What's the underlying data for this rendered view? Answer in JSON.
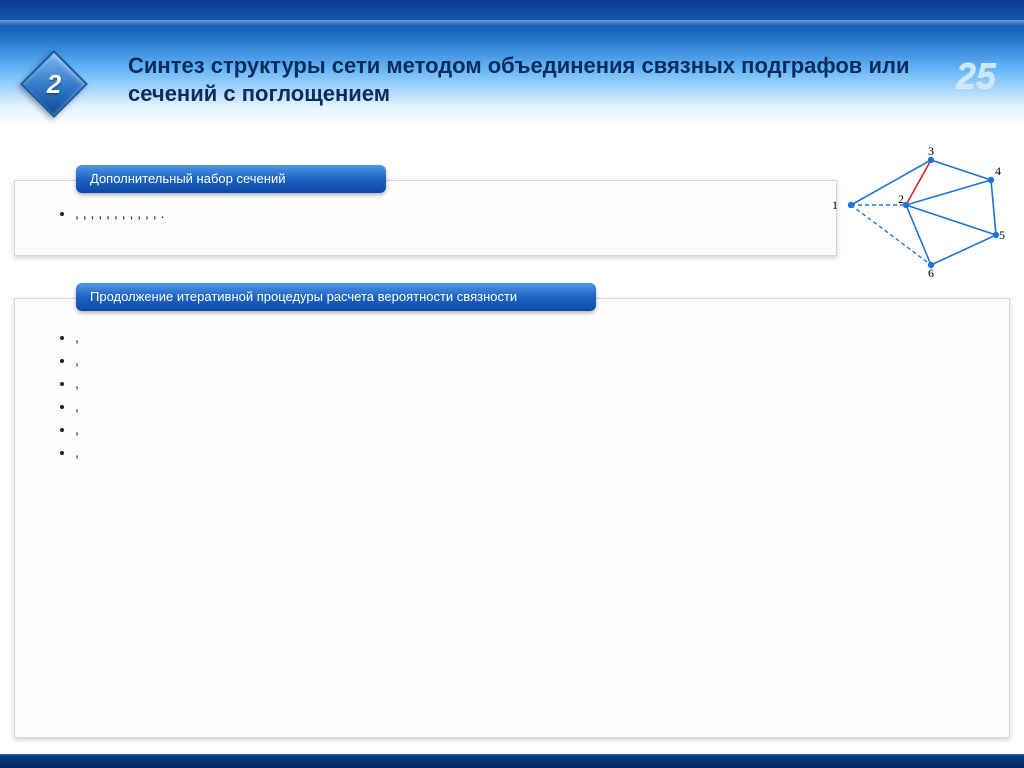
{
  "header": {
    "section_number": "2",
    "title": "Синтез структуры сети методом объединения связных подграфов или сечений с поглощением",
    "page": "25"
  },
  "panels": {
    "p1": {
      "label": "Дополнительный набор сечений",
      "items": [
        ", , , , , , , , , , , ."
      ]
    },
    "p2": {
      "label": "Продолжение итеративной процедуры расчета вероятности связности",
      "items": [
        ",",
        ",",
        ",",
        ",",
        ",",
        ","
      ]
    }
  },
  "graph": {
    "nodes": {
      "n1": "1",
      "n2": "2",
      "n3": "3",
      "n4": "4",
      "n5": "5",
      "n6": "6"
    }
  }
}
